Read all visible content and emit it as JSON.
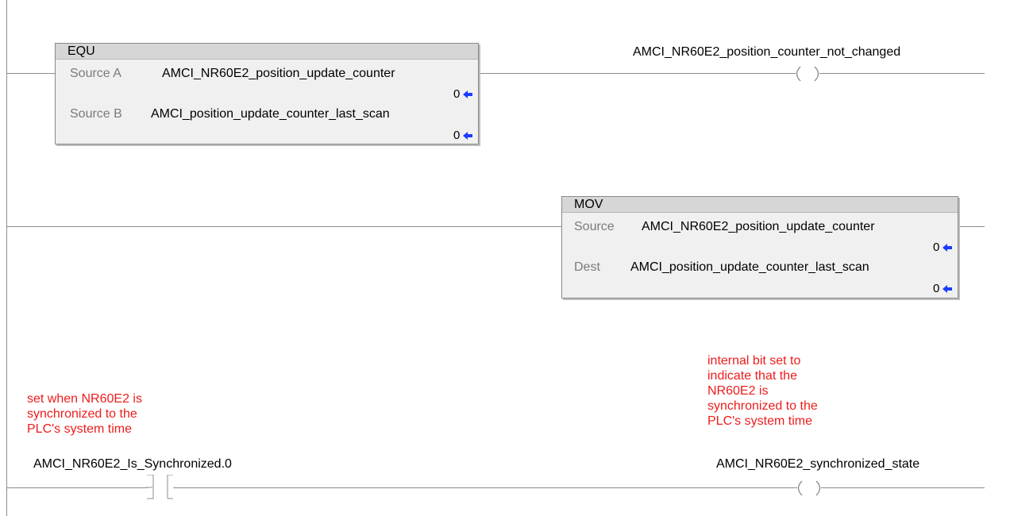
{
  "rung1": {
    "equ": {
      "title": "EQU",
      "source_a_label": "Source A",
      "source_a_tag": "AMCI_NR60E2_position_update_counter",
      "source_a_value": "0",
      "source_b_label": "Source B",
      "source_b_tag": "AMCI_position_update_counter_last_scan",
      "source_b_value": "0"
    },
    "coil_tag": "AMCI_NR60E2_position_counter_not_changed"
  },
  "rung2": {
    "mov": {
      "title": "MOV",
      "source_label": "Source",
      "source_tag": "AMCI_NR60E2_position_update_counter",
      "source_value": "0",
      "dest_label": "Dest",
      "dest_tag": "AMCI_position_update_counter_last_scan",
      "dest_value": "0"
    }
  },
  "rung3": {
    "contact_comment": "set when NR60E2 is\nsynchronized to the\nPLC's system time",
    "contact_tag": "AMCI_NR60E2_Is_Synchronized.0",
    "coil_comment": "internal bit set to\nindicate that the\nNR60E2 is\nsynchronized to the\nPLC's system time",
    "coil_tag": "AMCI_NR60E2_synchronized_state"
  },
  "colors": {
    "comment": "#ee1c1c",
    "value_arrow": "#1a3cff",
    "wire": "#8c8c8c"
  },
  "icons": {
    "value_arrow": "left-arrow-icon",
    "coil": "output-coil-icon",
    "contact": "examine-on-contact-icon"
  }
}
